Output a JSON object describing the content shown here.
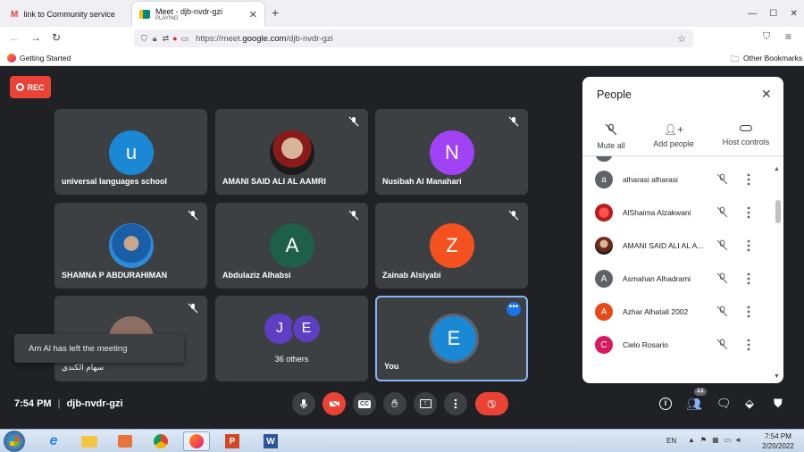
{
  "browser": {
    "tabs": [
      {
        "title": "link to Community service - e..."
      },
      {
        "title": "Meet - djb-nvdr-gzi",
        "subtitle": "PLAYING"
      }
    ],
    "new_tab": "+",
    "url_prefix": "https://meet.",
    "url_domain": "google.com",
    "url_path": "/djb-nvdr-gzi",
    "bookmark_getting_started": "Getting Started",
    "bookmark_other": "Other Bookmarks"
  },
  "meet": {
    "rec_label": "REC",
    "tiles": [
      {
        "name": "universal languages school",
        "initial": "u",
        "color": "#1a88d4"
      },
      {
        "name": "AMANI SAID ALI AL AAMRI",
        "initial": "",
        "color": "#8b1a1a"
      },
      {
        "name": "Nusibah Al Manahari",
        "initial": "N",
        "color": "#a142f4"
      },
      {
        "name": "SHAMNA P ABDURAHIMAN",
        "initial": "",
        "color": "#2b8bd8"
      },
      {
        "name": "Abdulaziz Alhabsi",
        "initial": "A",
        "color": "#1e5f4a"
      },
      {
        "name": "Zainab Alsiyabi",
        "initial": "Z",
        "color": "#f4511e"
      },
      {
        "name": "سهام الكندي",
        "initial": "u",
        "color": "#8d6e63"
      },
      {
        "name": "36 others",
        "initial": "",
        "color": "#5c3fc2"
      },
      {
        "name": "You",
        "initial": "E",
        "color": "#1a88d4"
      }
    ],
    "others_initials": [
      "J",
      "E"
    ],
    "toast": "Am Al has left the meeting",
    "time": "7:54 PM",
    "separator": "|",
    "meeting_code": "djb-nvdr-gzi",
    "participant_count": "44"
  },
  "people_panel": {
    "title": "People",
    "controls": {
      "mute_all": "Mute all",
      "add_people": "Add people",
      "host_controls": "Host controls"
    },
    "people": [
      {
        "name": "alharasi alharasi",
        "initial": "a",
        "color": "#5f6368"
      },
      {
        "name": "AlShaima Alzakwani",
        "initial": "",
        "color": "#c62828"
      },
      {
        "name": "AMANI SAID ALI AL A...",
        "initial": "",
        "color": "#6d2a1a"
      },
      {
        "name": "Asmahan Alhadrami",
        "initial": "A",
        "color": "#5f6368"
      },
      {
        "name": "Azhar Alhatali 2002",
        "initial": "A",
        "color": "#e64a19"
      },
      {
        "name": "Cielo Rosario",
        "initial": "C",
        "color": "#d81b60"
      }
    ]
  },
  "taskbar": {
    "language": "EN",
    "clock_time": "7:54 PM",
    "clock_date": "2/20/2022"
  }
}
